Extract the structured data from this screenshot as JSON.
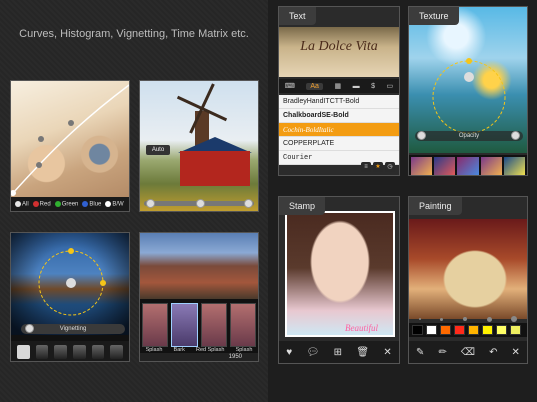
{
  "header": {
    "subtitle": "Curves, Histogram, Vignetting, Time Matrix etc."
  },
  "curves_card": {
    "channels": [
      {
        "label": "All",
        "color": "#e6e6e6"
      },
      {
        "label": "Red",
        "color": "#d03030"
      },
      {
        "label": "Green",
        "color": "#30b030"
      },
      {
        "label": "Blue",
        "color": "#3060d0"
      },
      {
        "label": "B/W",
        "color": "#ffffff"
      }
    ]
  },
  "histogram_card": {
    "auto_label": "Auto"
  },
  "vignetting_card": {
    "slider_label": "Vignetting"
  },
  "time_matrix_card": {
    "thumb_labels": [
      "Splash",
      "Bark",
      "Red Splash",
      "Splash"
    ],
    "counter": "1950"
  },
  "text_card": {
    "tab": "Text",
    "photo_title": "La Dolce Vita",
    "tool_aa": "Aa",
    "fonts": [
      "BradleyHandITCTT-Bold",
      "ChalkboardSE-Bold",
      "Cochin-BoldItalic",
      "COPPERPLATE",
      "Courier"
    ],
    "selected_font_index": 2
  },
  "texture_card": {
    "tab": "Texture",
    "opacity_label": "Opacity"
  },
  "stamp_card": {
    "tab": "Stamp",
    "stamp_text": "Beautiful"
  },
  "painting_card": {
    "tab": "Painting",
    "palette": [
      "#000000",
      "#ffffff",
      "#ff6a00",
      "#ff2a1a",
      "#ffb400",
      "#fff200",
      "#ffff66",
      "#f0f060"
    ]
  },
  "icons": {
    "heart": "heart-icon",
    "chat": "speech-bubble-icon",
    "stamp_add": "stamp-add-icon",
    "trash": "trash-icon",
    "close": "close-icon",
    "brush": "brush-icon",
    "pencil": "pencil-icon",
    "eraser": "eraser-icon",
    "undo": "undo-icon"
  }
}
